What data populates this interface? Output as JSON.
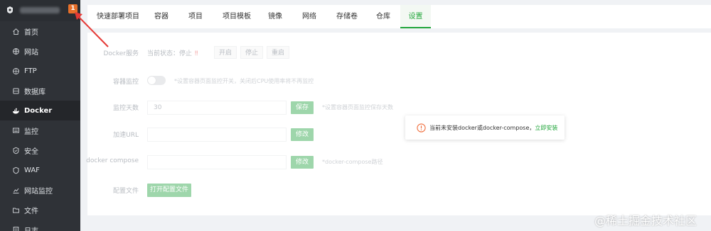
{
  "sidebar": {
    "badge": "1",
    "items": [
      {
        "label": "首页",
        "icon": "home-icon"
      },
      {
        "label": "网站",
        "icon": "globe-icon"
      },
      {
        "label": "FTP",
        "icon": "ftp-icon"
      },
      {
        "label": "数据库",
        "icon": "database-icon"
      },
      {
        "label": "Docker",
        "icon": "docker-icon"
      },
      {
        "label": "监控",
        "icon": "monitor-icon"
      },
      {
        "label": "安全",
        "icon": "shield-icon"
      },
      {
        "label": "WAF",
        "icon": "waf-icon"
      },
      {
        "label": "网站监控",
        "icon": "chart-icon"
      },
      {
        "label": "文件",
        "icon": "folder-icon"
      },
      {
        "label": "日志",
        "icon": "log-icon"
      }
    ],
    "active_item": "Docker"
  },
  "tabs": [
    {
      "label": "快速部署项目"
    },
    {
      "label": "容器"
    },
    {
      "label": "项目"
    },
    {
      "label": "项目模板"
    },
    {
      "label": "镜像"
    },
    {
      "label": "网络"
    },
    {
      "label": "存储卷"
    },
    {
      "label": "仓库"
    },
    {
      "label": "设置"
    }
  ],
  "active_tab": "设置",
  "settings": {
    "service_label": "Docker服务",
    "status_text": "当前状态：停止",
    "status_icon": "‼",
    "start_btn": "开启",
    "stop_btn": "停止",
    "restart_btn": "重启",
    "monitor_label": "容器监控",
    "monitor_hint": "*设置容器页面监控开关，关闭后CPU使用率将不再监控",
    "days_label": "监控天数",
    "days_value": "30",
    "save_btn": "保存",
    "days_hint": "*设置容器页面监控保存天数",
    "mirror_label": "加速URL",
    "modify_btn": "修改",
    "compose_label": "docker compose",
    "compose_btn": "修改",
    "compose_hint": "*docker-compose路径",
    "config_label": "配置文件",
    "open_config_btn": "打开配置文件"
  },
  "toast": {
    "message": "当前未安装docker或docker-compose，",
    "link": "立即安装"
  },
  "watermark": "@稀土掘金技术社区",
  "colors": {
    "sidebar_bg": "#2f3237",
    "accent": "#20a53a",
    "badge": "#e8702a",
    "warning": "#f0703f"
  }
}
